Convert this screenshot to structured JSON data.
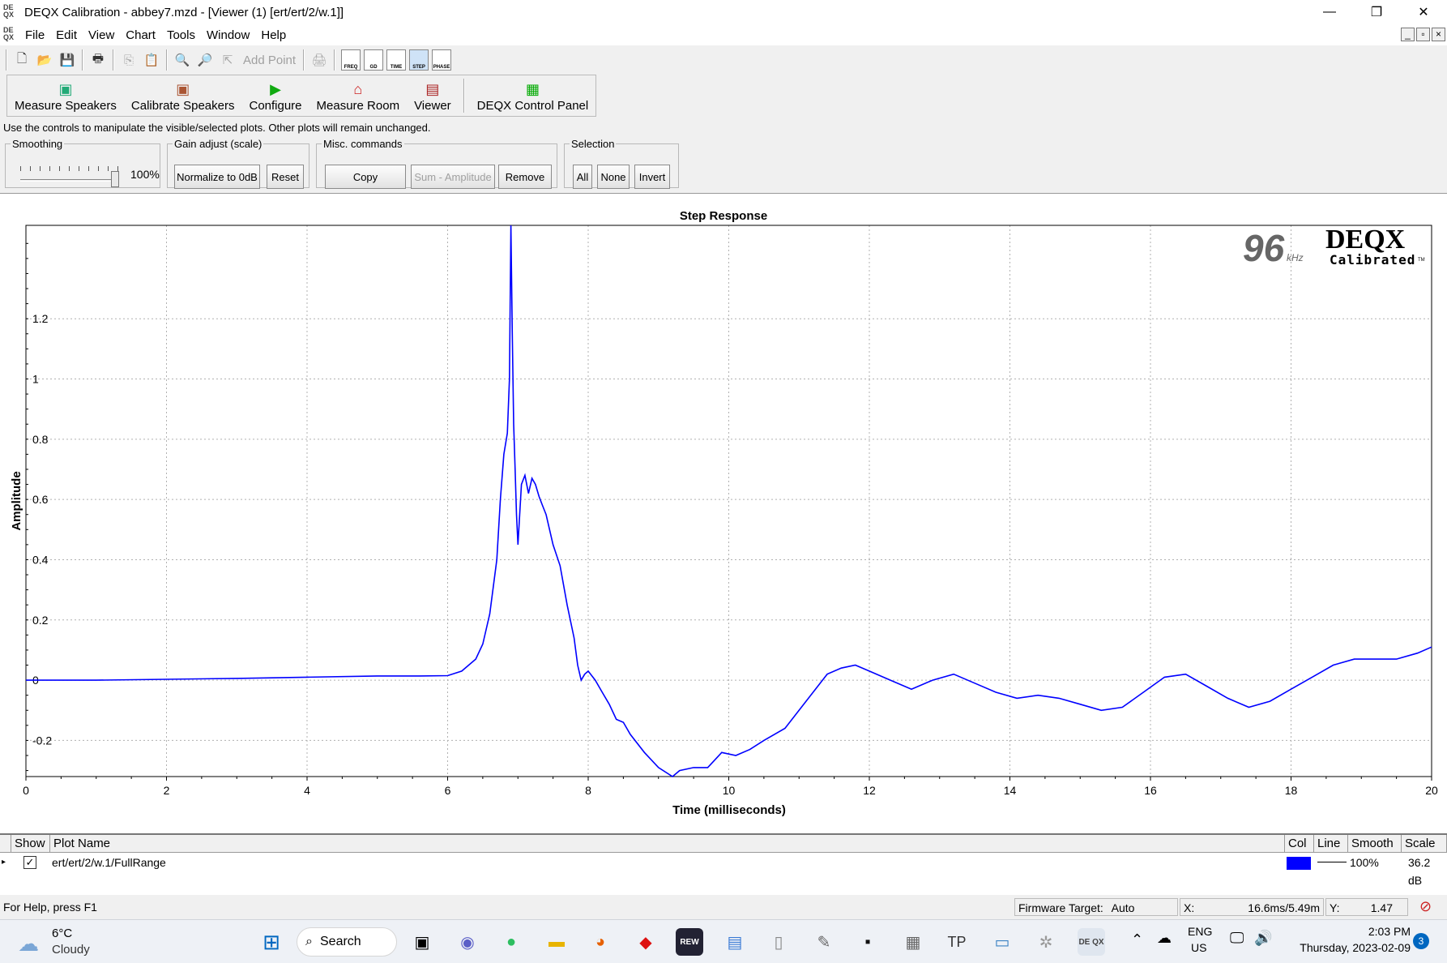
{
  "window": {
    "title": "DEQX Calibration - abbey7.mzd - [Viewer (1) [ert/ert/2/w.1]]",
    "app_icon_text": "DE QX",
    "minimize": "—",
    "restore": "❐",
    "close": "✕"
  },
  "menu": {
    "items": [
      "File",
      "Edit",
      "View",
      "Chart",
      "Tools",
      "Window",
      "Help"
    ],
    "mdi_controls": [
      "_",
      "▫",
      "×"
    ]
  },
  "toolbar": {
    "add_point_label": "Add Point",
    "view_buttons": [
      "FREQ",
      "GD",
      "TIME",
      "STEP",
      "PHASE"
    ]
  },
  "main_buttons": {
    "measure_speakers": "Measure Speakers",
    "calibrate_speakers": "Calibrate Speakers",
    "configure": "Configure",
    "measure_room": "Measure Room",
    "viewer": "Viewer",
    "deqx_control_panel": "DEQX Control Panel"
  },
  "hint_text": "Use the controls to manipulate the visible/selected plots.  Other plots will remain unchanged.",
  "smoothing": {
    "legend": "Smoothing",
    "value_text": "100%",
    "level": 1.0
  },
  "gain_adjust": {
    "legend": "Gain adjust (scale)",
    "normalize": "Normalize to 0dB",
    "reset": "Reset"
  },
  "misc": {
    "legend": "Misc. commands",
    "copy": "Copy",
    "sum_amplitude": "Sum - Amplitude",
    "remove": "Remove"
  },
  "selection": {
    "legend": "Selection",
    "all": "All",
    "none": "None",
    "invert": "Invert"
  },
  "logo": {
    "rate": "96",
    "rate_unit": "kHz",
    "brand": "DEQX",
    "brand_sub": "Calibrated",
    "tm": "TM"
  },
  "chart_data": {
    "type": "line",
    "title": "Step Response",
    "xlabel": "Time (milliseconds)",
    "ylabel": "Amplitude",
    "xlim": [
      0,
      20
    ],
    "ylim": [
      -0.32,
      1.51
    ],
    "x_ticks": [
      "0",
      "2",
      "4",
      "6",
      "8",
      "10",
      "12",
      "14",
      "16",
      "18",
      "20"
    ],
    "y_ticks": [
      "-0.2",
      "0",
      "0.2",
      "0.4",
      "0.6",
      "0.8",
      "1",
      "1.2"
    ],
    "grid": true,
    "series": [
      {
        "name": "ert/ert/2/w.1/FullRange",
        "color": "#0000ff",
        "x": [
          0,
          1,
          2,
          3,
          4,
          5,
          5.6,
          6,
          6.2,
          6.4,
          6.5,
          6.6,
          6.7,
          6.75,
          6.8,
          6.85,
          6.88,
          6.9,
          6.92,
          6.94,
          6.96,
          6.98,
          7.0,
          7.05,
          7.1,
          7.15,
          7.2,
          7.25,
          7.3,
          7.35,
          7.4,
          7.45,
          7.5,
          7.6,
          7.7,
          7.8,
          7.85,
          7.9,
          7.95,
          8.0,
          8.1,
          8.2,
          8.3,
          8.4,
          8.5,
          8.6,
          8.8,
          9.0,
          9.2,
          9.3,
          9.5,
          9.7,
          9.9,
          10.1,
          10.3,
          10.5,
          10.8,
          11.1,
          11.4,
          11.6,
          11.8,
          12.0,
          12.3,
          12.6,
          12.9,
          13.2,
          13.5,
          13.8,
          14.1,
          14.4,
          14.7,
          15.0,
          15.3,
          15.6,
          15.9,
          16.2,
          16.5,
          16.8,
          17.1,
          17.4,
          17.7,
          18.0,
          18.3,
          18.6,
          18.9,
          19.2,
          19.5,
          19.8,
          20.0
        ],
        "y": [
          0.0,
          0.0,
          0.003,
          0.006,
          0.01,
          0.014,
          0.014,
          0.015,
          0.03,
          0.07,
          0.12,
          0.22,
          0.4,
          0.6,
          0.75,
          0.82,
          1.0,
          1.51,
          1.15,
          0.85,
          0.7,
          0.55,
          0.45,
          0.65,
          0.68,
          0.62,
          0.67,
          0.65,
          0.61,
          0.58,
          0.55,
          0.5,
          0.45,
          0.38,
          0.25,
          0.14,
          0.05,
          0.0,
          0.02,
          0.03,
          0.0,
          -0.04,
          -0.08,
          -0.13,
          -0.14,
          -0.18,
          -0.24,
          -0.29,
          -0.32,
          -0.3,
          -0.29,
          -0.29,
          -0.24,
          -0.25,
          -0.23,
          -0.2,
          -0.16,
          -0.07,
          0.02,
          0.04,
          0.05,
          0.03,
          0.0,
          -0.03,
          0.0,
          0.02,
          -0.01,
          -0.04,
          -0.06,
          -0.05,
          -0.06,
          -0.08,
          -0.1,
          -0.09,
          -0.04,
          0.01,
          0.02,
          -0.02,
          -0.06,
          -0.09,
          -0.07,
          -0.03,
          0.01,
          0.05,
          0.07,
          0.07,
          0.07,
          0.09,
          0.11
        ]
      }
    ]
  },
  "plot_list": {
    "headers": {
      "show": "Show",
      "name": "Plot Name",
      "col": "Col",
      "line": "Line",
      "smooth": "Smooth",
      "scale": "Scale"
    },
    "rows": [
      {
        "checked": "✓",
        "name": "ert/ert/2/w.1/FullRange",
        "color": "#0000ff",
        "smooth": "100%",
        "scale": "36.2 dB"
      }
    ]
  },
  "statusbar": {
    "help": "For Help, press F1",
    "firmware_label": "Firmware Target:",
    "firmware_value": "Auto",
    "x_label": "X:",
    "x_value": "16.6ms/5.49m",
    "y_label": "Y:",
    "y_value": "1.47"
  },
  "taskbar": {
    "weather_temp": "6°C",
    "weather_desc": "Cloudy",
    "search": "Search",
    "lang": "ENG",
    "region": "US",
    "time": "2:03 PM",
    "date": "Thursday, 2023-02-09",
    "notif_count": "3",
    "rew_label": "REW",
    "tp_label": "TP",
    "deqx_label": "DE QX"
  }
}
